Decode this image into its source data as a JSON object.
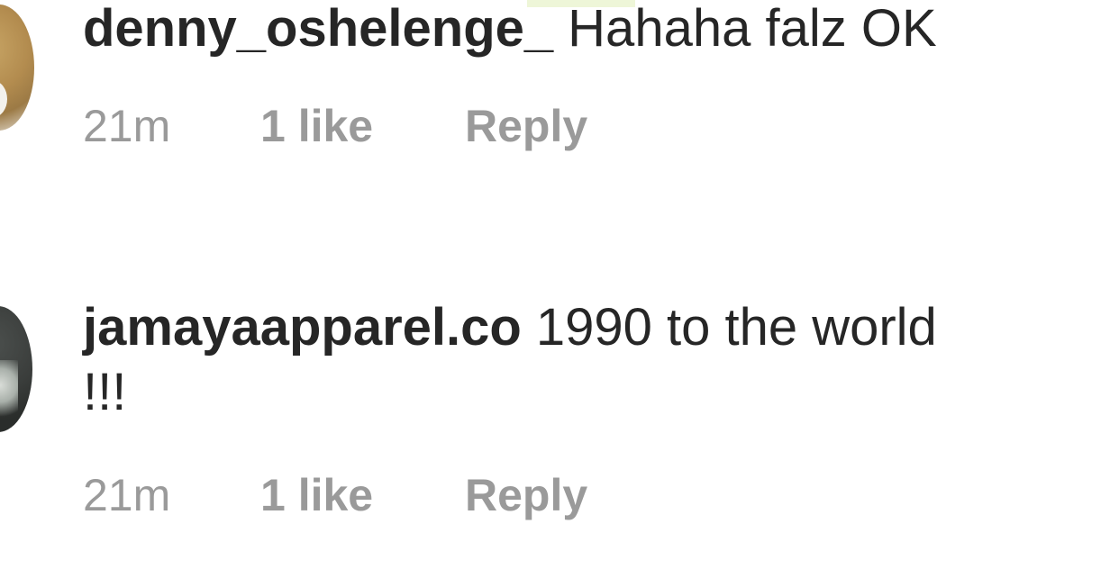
{
  "comments": [
    {
      "username": "denny_oshelenge_",
      "text": "Hahaha falz OK",
      "time": "21m",
      "likes": "1 like",
      "reply_label": "Reply"
    },
    {
      "username": "jamayaapparel.co",
      "text": "1990 to the world !!!",
      "time": "21m",
      "likes": "1 like",
      "reply_label": "Reply"
    }
  ]
}
